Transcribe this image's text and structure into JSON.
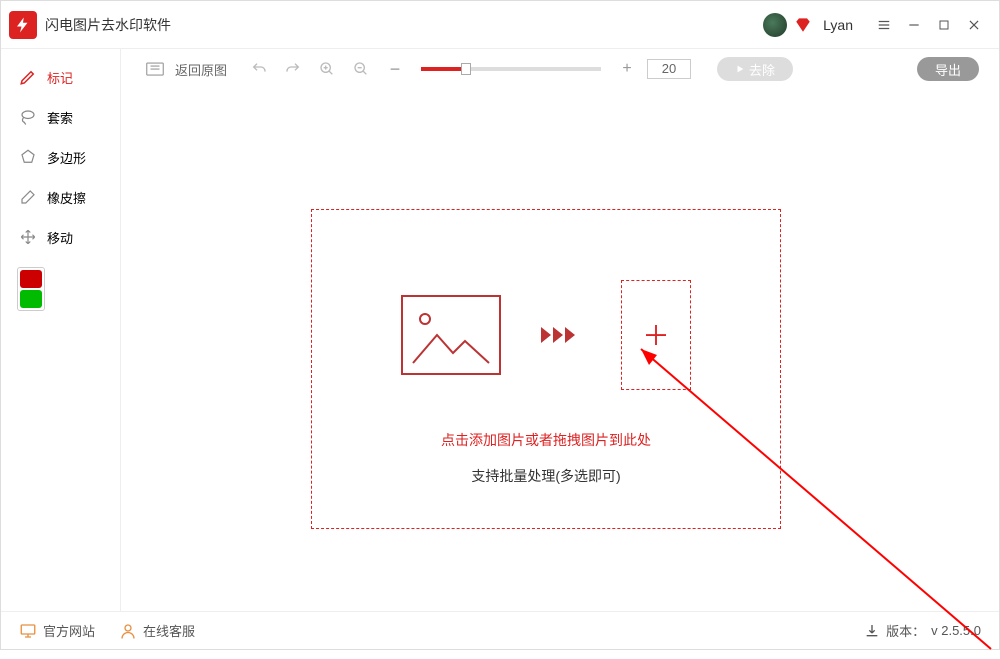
{
  "titlebar": {
    "app_title": "闪电图片去水印软件",
    "username": "Lyan"
  },
  "sidebar": {
    "tools": [
      {
        "label": "标记"
      },
      {
        "label": "套索"
      },
      {
        "label": "多边形"
      },
      {
        "label": "橡皮擦"
      },
      {
        "label": "移动"
      }
    ],
    "color1": "#c00",
    "color2": "#0b0"
  },
  "toolbar": {
    "return_label": "返回原图",
    "zoom_value": "20",
    "remove_label": "去除",
    "export_label": "导出"
  },
  "dropzone": {
    "line1": "点击添加图片或者拖拽图片到此处",
    "line2": "支持批量处理(多选即可)"
  },
  "statusbar": {
    "site_label": "官方网站",
    "service_label": "在线客服",
    "version_prefix": "版本：",
    "version": "v 2.5.5.0"
  }
}
